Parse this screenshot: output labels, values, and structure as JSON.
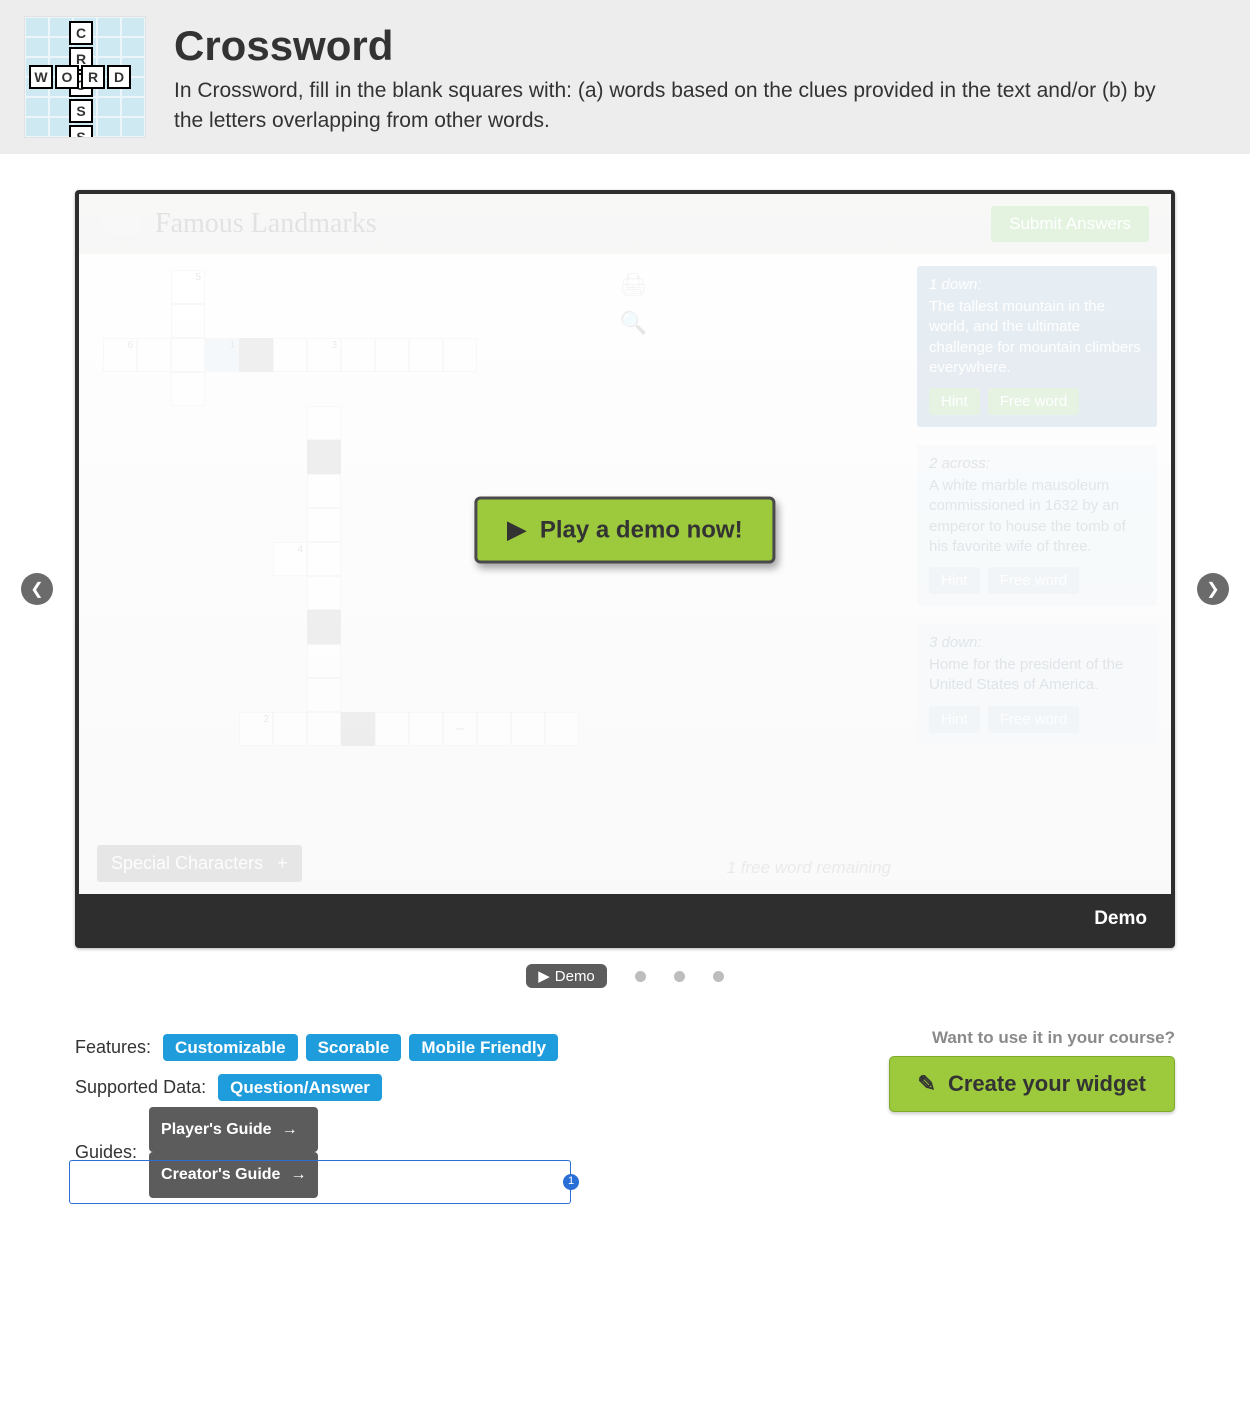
{
  "header": {
    "title": "Crossword",
    "description": "In Crossword, fill in the blank squares with: (a) words based on the clues provided in the text and/or (b) by the letters overlapping from other words.",
    "logo_letters_v": [
      "C",
      "R",
      "O",
      "S",
      "S"
    ],
    "logo_letters_h": [
      "W",
      "O",
      "R",
      "D"
    ]
  },
  "game": {
    "title": "Famous Landmarks",
    "submit": "Submit Answers",
    "special_chars": "Special Characters",
    "free_word_status": "1 free word remaining",
    "cells": [
      {
        "c": 2,
        "r": 0,
        "n": "5"
      },
      {
        "c": 2,
        "r": 1
      },
      {
        "c": 0,
        "r": 2,
        "n": "6"
      },
      {
        "c": 1,
        "r": 2
      },
      {
        "c": 2,
        "r": 2
      },
      {
        "c": 3,
        "r": 2,
        "n": "1",
        "sel": true
      },
      {
        "c": 4,
        "r": 2,
        "black": true
      },
      {
        "c": 5,
        "r": 2
      },
      {
        "c": 6,
        "r": 2,
        "n": "3"
      },
      {
        "c": 7,
        "r": 2
      },
      {
        "c": 8,
        "r": 2
      },
      {
        "c": 9,
        "r": 2
      },
      {
        "c": 10,
        "r": 2
      },
      {
        "c": 2,
        "r": 3
      },
      {
        "c": 6,
        "r": 4
      },
      {
        "c": 6,
        "r": 5,
        "black": true
      },
      {
        "c": 6,
        "r": 6
      },
      {
        "c": 6,
        "r": 7
      },
      {
        "c": 5,
        "r": 8,
        "n": "4"
      },
      {
        "c": 6,
        "r": 8
      },
      {
        "c": 6,
        "r": 9
      },
      {
        "c": 6,
        "r": 10,
        "black": true
      },
      {
        "c": 6,
        "r": 11
      },
      {
        "c": 6,
        "r": 12
      },
      {
        "c": 4,
        "r": 13,
        "n": "2"
      },
      {
        "c": 5,
        "r": 13
      },
      {
        "c": 6,
        "r": 13
      },
      {
        "c": 7,
        "r": 13,
        "black": true
      },
      {
        "c": 8,
        "r": 13
      },
      {
        "c": 9,
        "r": 13
      },
      {
        "c": 10,
        "r": 13,
        "txt": "–"
      },
      {
        "c": 11,
        "r": 13
      },
      {
        "c": 12,
        "r": 13
      },
      {
        "c": 13,
        "r": 13
      }
    ],
    "clues": [
      {
        "label": "1 down:",
        "text": "The tallest mountain in the world, and the ultimate challenge for mountain climbers everywhere.",
        "hint": "Hint",
        "free": "Free word",
        "active": true
      },
      {
        "label": "2 across:",
        "text": "A white marble mausoleum commissioned in 1632 by an emperor to house the tomb of his favorite wife of three.",
        "hint": "Hint",
        "free": "Free word",
        "active": false
      },
      {
        "label": "3 down:",
        "text": "Home for the president of the United States of America.",
        "hint": "Hint",
        "free": "Free word",
        "active": false
      }
    ],
    "play_demo": "Play a demo now!",
    "caption": "Demo"
  },
  "carousel": {
    "chip": "Demo"
  },
  "meta": {
    "features_label": "Features:",
    "features": [
      "Customizable",
      "Scorable",
      "Mobile Friendly"
    ],
    "data_label": "Supported Data:",
    "data": [
      "Question/Answer"
    ],
    "guides_label": "Guides:",
    "guides": [
      "Player's Guide",
      "Creator's Guide"
    ],
    "outline_badge": "1"
  },
  "cta": {
    "question": "Want to use it in your course?",
    "button": "Create your widget"
  }
}
